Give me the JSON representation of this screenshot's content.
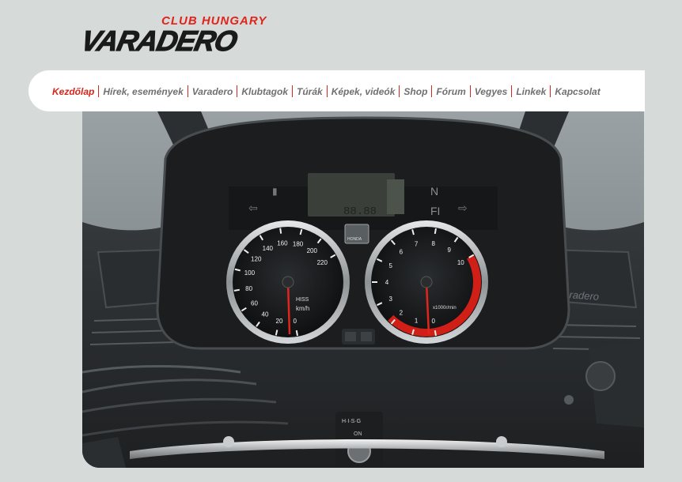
{
  "logo": {
    "subtitle": "CLUB HUNGARY",
    "wordmark": "VARADERO",
    "accent_color": "#e2231a"
  },
  "nav": {
    "items": [
      {
        "label": "Kezdőlap",
        "active": true
      },
      {
        "label": "Hírek, események",
        "active": false
      },
      {
        "label": "Varadero",
        "active": false
      },
      {
        "label": "Klubtagok",
        "active": false
      },
      {
        "label": "Túrák",
        "active": false
      },
      {
        "label": "Képek, videók",
        "active": false
      },
      {
        "label": "Shop",
        "active": false
      },
      {
        "label": "Fórum",
        "active": false
      },
      {
        "label": "Vegyes",
        "active": false
      },
      {
        "label": "Linkek",
        "active": false
      },
      {
        "label": "Kapcsolat",
        "active": false
      }
    ],
    "active_color": "#d7261c",
    "text_color": "#707070"
  },
  "hero": {
    "indicators": {
      "neutral": "N",
      "fi": "FI"
    },
    "brand": "HONDA",
    "speedo": {
      "ticks": [
        "0",
        "20",
        "40",
        "60",
        "80",
        "100",
        "120",
        "140",
        "160",
        "180",
        "200",
        "220"
      ],
      "unit": "km/h",
      "label": "HISS"
    },
    "tacho": {
      "ticks": [
        "0",
        "1",
        "2",
        "3",
        "4",
        "5",
        "6",
        "7",
        "8",
        "9",
        "10"
      ],
      "unit": "x1000r/min"
    },
    "hisg": "H·I·S·G",
    "on": "ON",
    "model_badge": "Varadero"
  }
}
